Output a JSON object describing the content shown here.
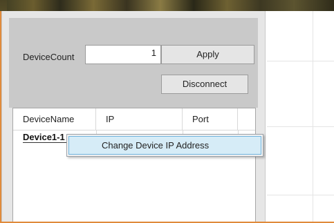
{
  "device_panel": {
    "device_count_label": "DeviceCount",
    "device_count_value": "1",
    "apply_label": "Apply",
    "disconnect_label": "Disconnect"
  },
  "device_table": {
    "columns": [
      "DeviceName",
      "IP",
      "Port"
    ],
    "rows": [
      {
        "name": "Device1-1"
      }
    ]
  },
  "context_menu": {
    "items": [
      "Change Device IP Address"
    ]
  },
  "colors": {
    "panel_bg": "#c9c9c9",
    "menu_highlight": "#d6ecf7",
    "menu_highlight_border": "#6fb3dd",
    "window_accent": "#e08a3a"
  }
}
